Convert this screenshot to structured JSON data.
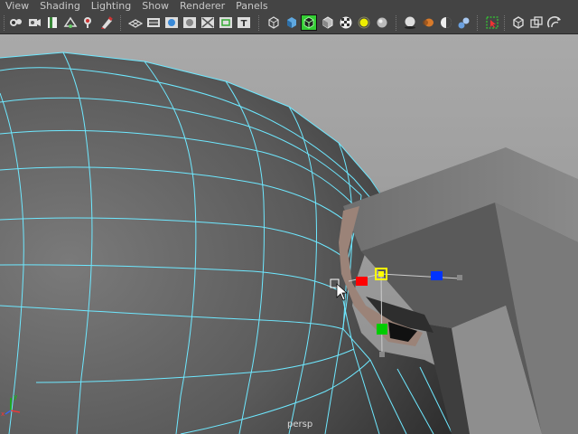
{
  "menu": {
    "items": [
      "View",
      "Shading",
      "Lighting",
      "Show",
      "Renderer",
      "Panels"
    ]
  },
  "toolbar": {
    "icons": [
      "camera-select-icon",
      "camera-attributes-icon",
      "bookmarks-icon",
      "image-plane-icon",
      "2d-pan-zoom-icon",
      "grease-pencil-icon",
      "grid-icon",
      "film-gate-icon",
      "resolution-gate-icon",
      "gate-mask-icon",
      "field-chart-icon",
      "safe-action-icon",
      "safe-title-icon",
      "wireframe-icon",
      "smooth-shade-icon",
      "wireframe-on-shaded-icon",
      "xray-icon",
      "default-material-icon",
      "use-all-lights-icon",
      "shadows-icon",
      "ambient-occlusion-icon",
      "motion-blur-icon",
      "anti-aliasing-icon",
      "depth-of-field-icon",
      "isolate-select-icon",
      "xray-joints-icon",
      "xray-active-icon",
      "two-sided-lighting-icon"
    ]
  },
  "viewport": {
    "camera_label": "persp",
    "axis_labels": {
      "x": "x",
      "y": "y"
    },
    "manipulator_colors": {
      "x_axis": "#ff0000",
      "y_axis": "#00cc00",
      "z_axis": "#0033ff",
      "center": "#ffff00"
    },
    "wire_color": "#6ee8ff"
  }
}
